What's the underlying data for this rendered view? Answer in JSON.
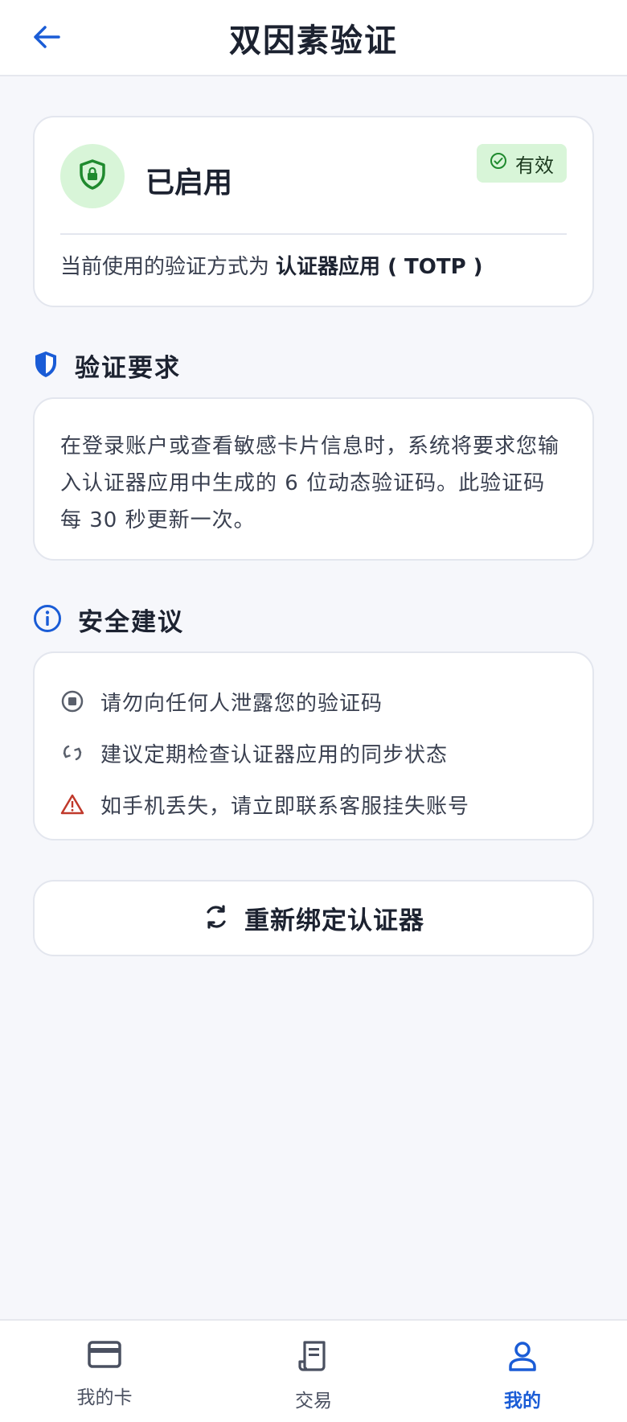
{
  "header": {
    "title": "双因素验证",
    "back_icon": "arrow-left-icon"
  },
  "status": {
    "title": "已启用",
    "badge": "有效",
    "method_prefix": "当前使用的验证方式为",
    "method_value": "认证器应用 ( TOTP )"
  },
  "requirement": {
    "heading": "验证要求",
    "text": "在登录账户或查看敏感卡片信息时，系统将要求您输入认证器应用中生成的 6 位动态验证码。此验证码每 30 秒更新一次。"
  },
  "tips": {
    "heading": "安全建议",
    "items": [
      {
        "icon": "stop-icon",
        "text": "请勿向任何人泄露您的验证码"
      },
      {
        "icon": "sync-icon",
        "text": "建议定期检查认证器应用的同步状态"
      },
      {
        "icon": "warning-icon",
        "text": "如手机丢失，请立即联系客服挂失账号"
      }
    ]
  },
  "actions": {
    "rebind_label": "重新绑定认证器"
  },
  "bottom_nav": {
    "items": [
      {
        "label": "我的卡",
        "icon": "card-icon",
        "active": false
      },
      {
        "label": "交易",
        "icon": "receipt-icon",
        "active": false
      },
      {
        "label": "我的",
        "icon": "user-icon",
        "active": true
      }
    ]
  },
  "colors": {
    "accent": "#1a5cd6",
    "success_bg": "#d8f5d8",
    "success": "#1f8a2e",
    "danger": "#c0392b"
  }
}
